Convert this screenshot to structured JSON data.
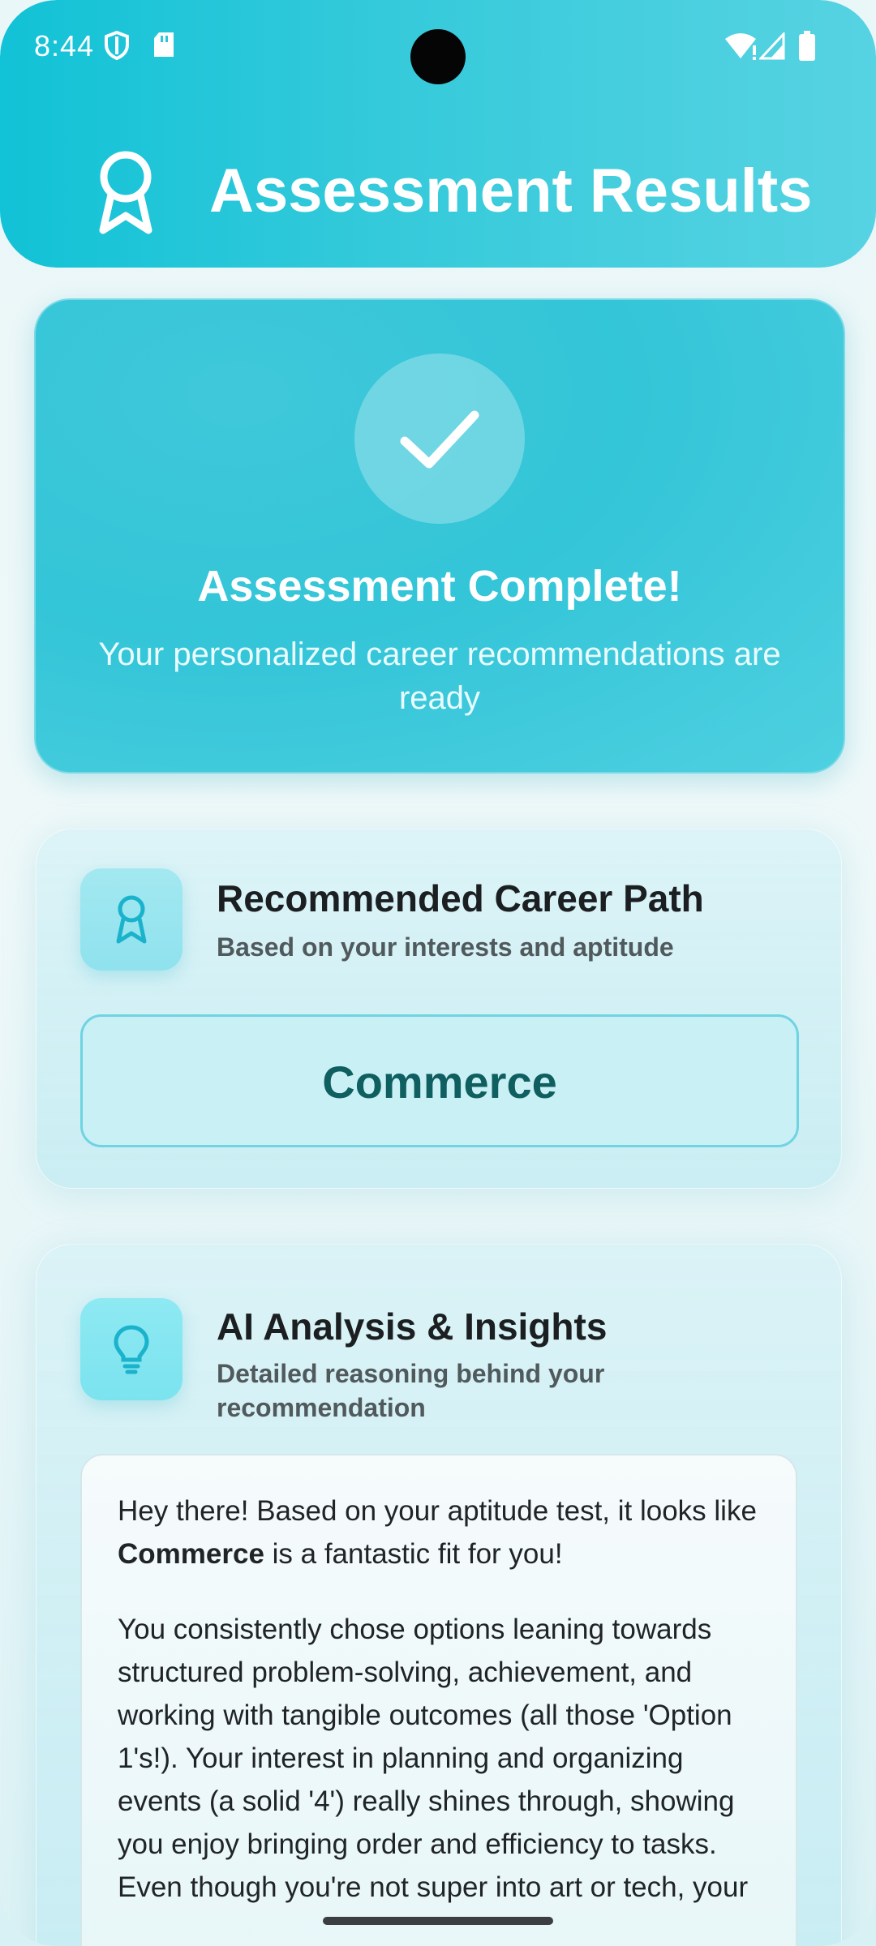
{
  "status_bar": {
    "time": "8:44"
  },
  "header": {
    "title": "Assessment Results"
  },
  "hero": {
    "title": "Assessment Complete!",
    "subtitle": "Your personalized career recommendations are ready"
  },
  "career_card": {
    "title": "Recommended Career Path",
    "subtitle": "Based on your interests and aptitude",
    "career": "Commerce"
  },
  "analysis_card": {
    "title": "AI Analysis & Insights",
    "subtitle": "Detailed reasoning behind your recommendation",
    "para1_before": "Hey there! Based on your aptitude test, it looks like ",
    "para1_bold": "Commerce",
    "para1_after": " is a fantastic fit for you!",
    "para2": "You consistently chose options leaning towards structured problem-solving, achievement, and working with tangible outcomes (all those 'Option 1's!). Your interest in planning and organizing events (a solid '4') really shines through, showing you enjoy bringing order and efficiency to tasks. Even though you're not super into art or tech, your"
  },
  "colors": {
    "accent": "#2ec6d9",
    "career_text": "#0f5f60"
  }
}
